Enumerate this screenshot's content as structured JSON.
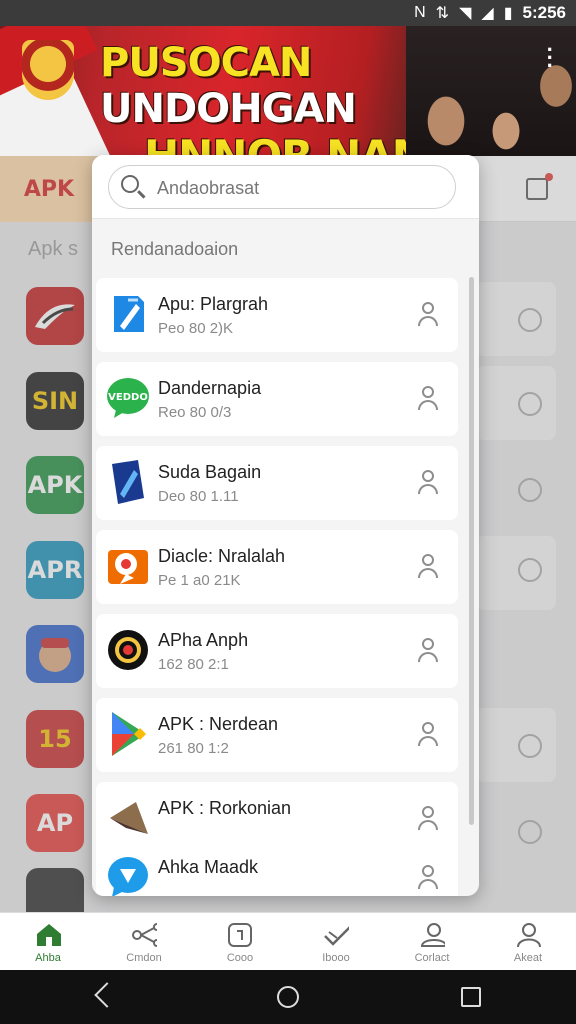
{
  "status_bar": {
    "time": "5:256"
  },
  "banner": {
    "title_line1_a": "PUSOCAN ",
    "title_line1_b": "UNDOHGAN",
    "title_line2": "HNNOR NANA"
  },
  "app": {
    "logo_text": "APK",
    "section_label": "Apk s"
  },
  "background_icons": [
    "",
    "SIN",
    "APK",
    "APR",
    "",
    "15",
    "AP",
    ""
  ],
  "popup": {
    "search": {
      "placeholder": "Andaobrasat"
    },
    "subtitle": "Rendanadoaion",
    "items": [
      {
        "name": "Apu: Plargrah",
        "meta": "Peo 80 2)K",
        "icon": "blue-pencil-app-icon"
      },
      {
        "name": "Dandernapia",
        "meta": "Reo 80 0/3",
        "icon": "green-speech-app-icon",
        "icon_text": "VEDDO"
      },
      {
        "name": "Suda Bagain",
        "meta": "Deo 80 1.11",
        "icon": "blue-book-app-icon"
      },
      {
        "name": "Diacle: Nralalah",
        "meta": "Pe 1 a0 21K",
        "icon": "orange-pin-app-icon"
      },
      {
        "name": "APha Anph",
        "meta": "162 80 2:1",
        "icon": "record-circle-app-icon"
      },
      {
        "name": "APK : Nerdean",
        "meta": "261 80 1:2",
        "icon": "play-store-app-icon"
      },
      {
        "name": "APK : Rorkonian",
        "meta": "",
        "icon": "arrow-tag-app-icon"
      },
      {
        "name": "Ahka Maadk",
        "meta": "",
        "icon": "blue-chat-app-icon"
      }
    ]
  },
  "bottom_nav": [
    {
      "label": "Ahba",
      "icon": "home-icon",
      "active": true
    },
    {
      "label": "Cmdon",
      "icon": "share-icon",
      "active": false
    },
    {
      "label": "Cooo",
      "icon": "square-icon",
      "active": false
    },
    {
      "label": "Ibooo",
      "icon": "check-icon",
      "active": false
    },
    {
      "label": "Corlact",
      "icon": "cloud-user-icon",
      "active": false
    },
    {
      "label": "Akeat",
      "icon": "profile-icon",
      "active": false
    }
  ]
}
